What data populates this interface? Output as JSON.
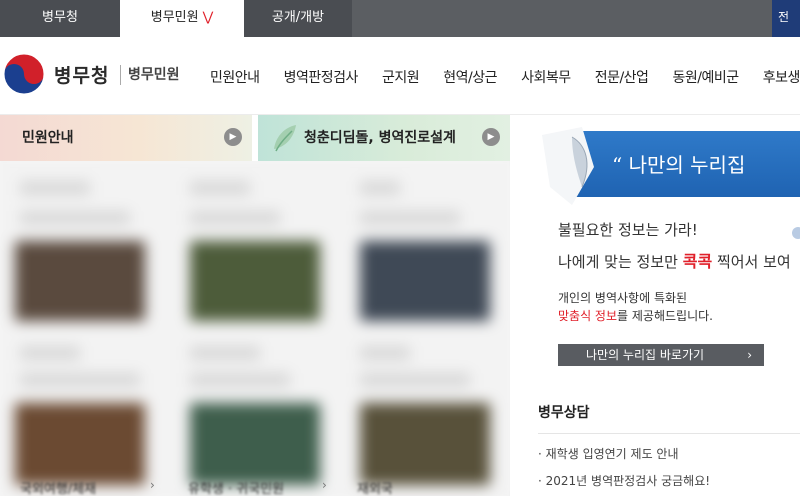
{
  "top_tabs": [
    {
      "label": "병무청"
    },
    {
      "label": "병무민원",
      "chevron": "⋁",
      "active": true
    },
    {
      "label": "공개/개방"
    }
  ],
  "top_corner_label": "전",
  "header": {
    "logo_main": "병무청",
    "logo_sub": "병무민원",
    "nav": [
      "민원안내",
      "병역판정검사",
      "군지원",
      "현역/상근",
      "사회복무",
      "전문/산업",
      "동원/예비군",
      "후보생/공보"
    ]
  },
  "left": {
    "pane1_title": "민원안내",
    "pane2_title": "청춘디딤돌, 병역진로설계",
    "bottom_captions": [
      "국외여행/체재",
      "유학생 · 귀국민원",
      "재외국"
    ]
  },
  "right": {
    "banner_text": "“ 나만의 누리집",
    "promo_line1": "불필요한 정보는 가라!",
    "promo_line2_pre": "나에게 맞는 정보만 ",
    "promo_line2_red": "콕콕",
    "promo_line2_post": " 찍어서 보여",
    "promo_line3": "개인의 병역사항에 특화된",
    "promo_line4_red": "맞춤식 정보",
    "promo_line4_post": "를 제공해드립니다.",
    "go_button": "나만의 누리집 바로가기",
    "consult_title": "병무상담",
    "consult_items": [
      "· 재학생 입영연기 제도 안내",
      "· 2021년 병역판정검사 궁금해요!"
    ]
  },
  "colors": {
    "topbar": "#5b5e62",
    "accent_red": "#e0202a",
    "banner_blue": "#2f7ac9",
    "button_gray": "#595c61"
  },
  "icons": {
    "emblem": "korea-taegeuk-emblem",
    "pane_more": "circle-arrow-right-icon",
    "leaf": "leaf-icon"
  }
}
